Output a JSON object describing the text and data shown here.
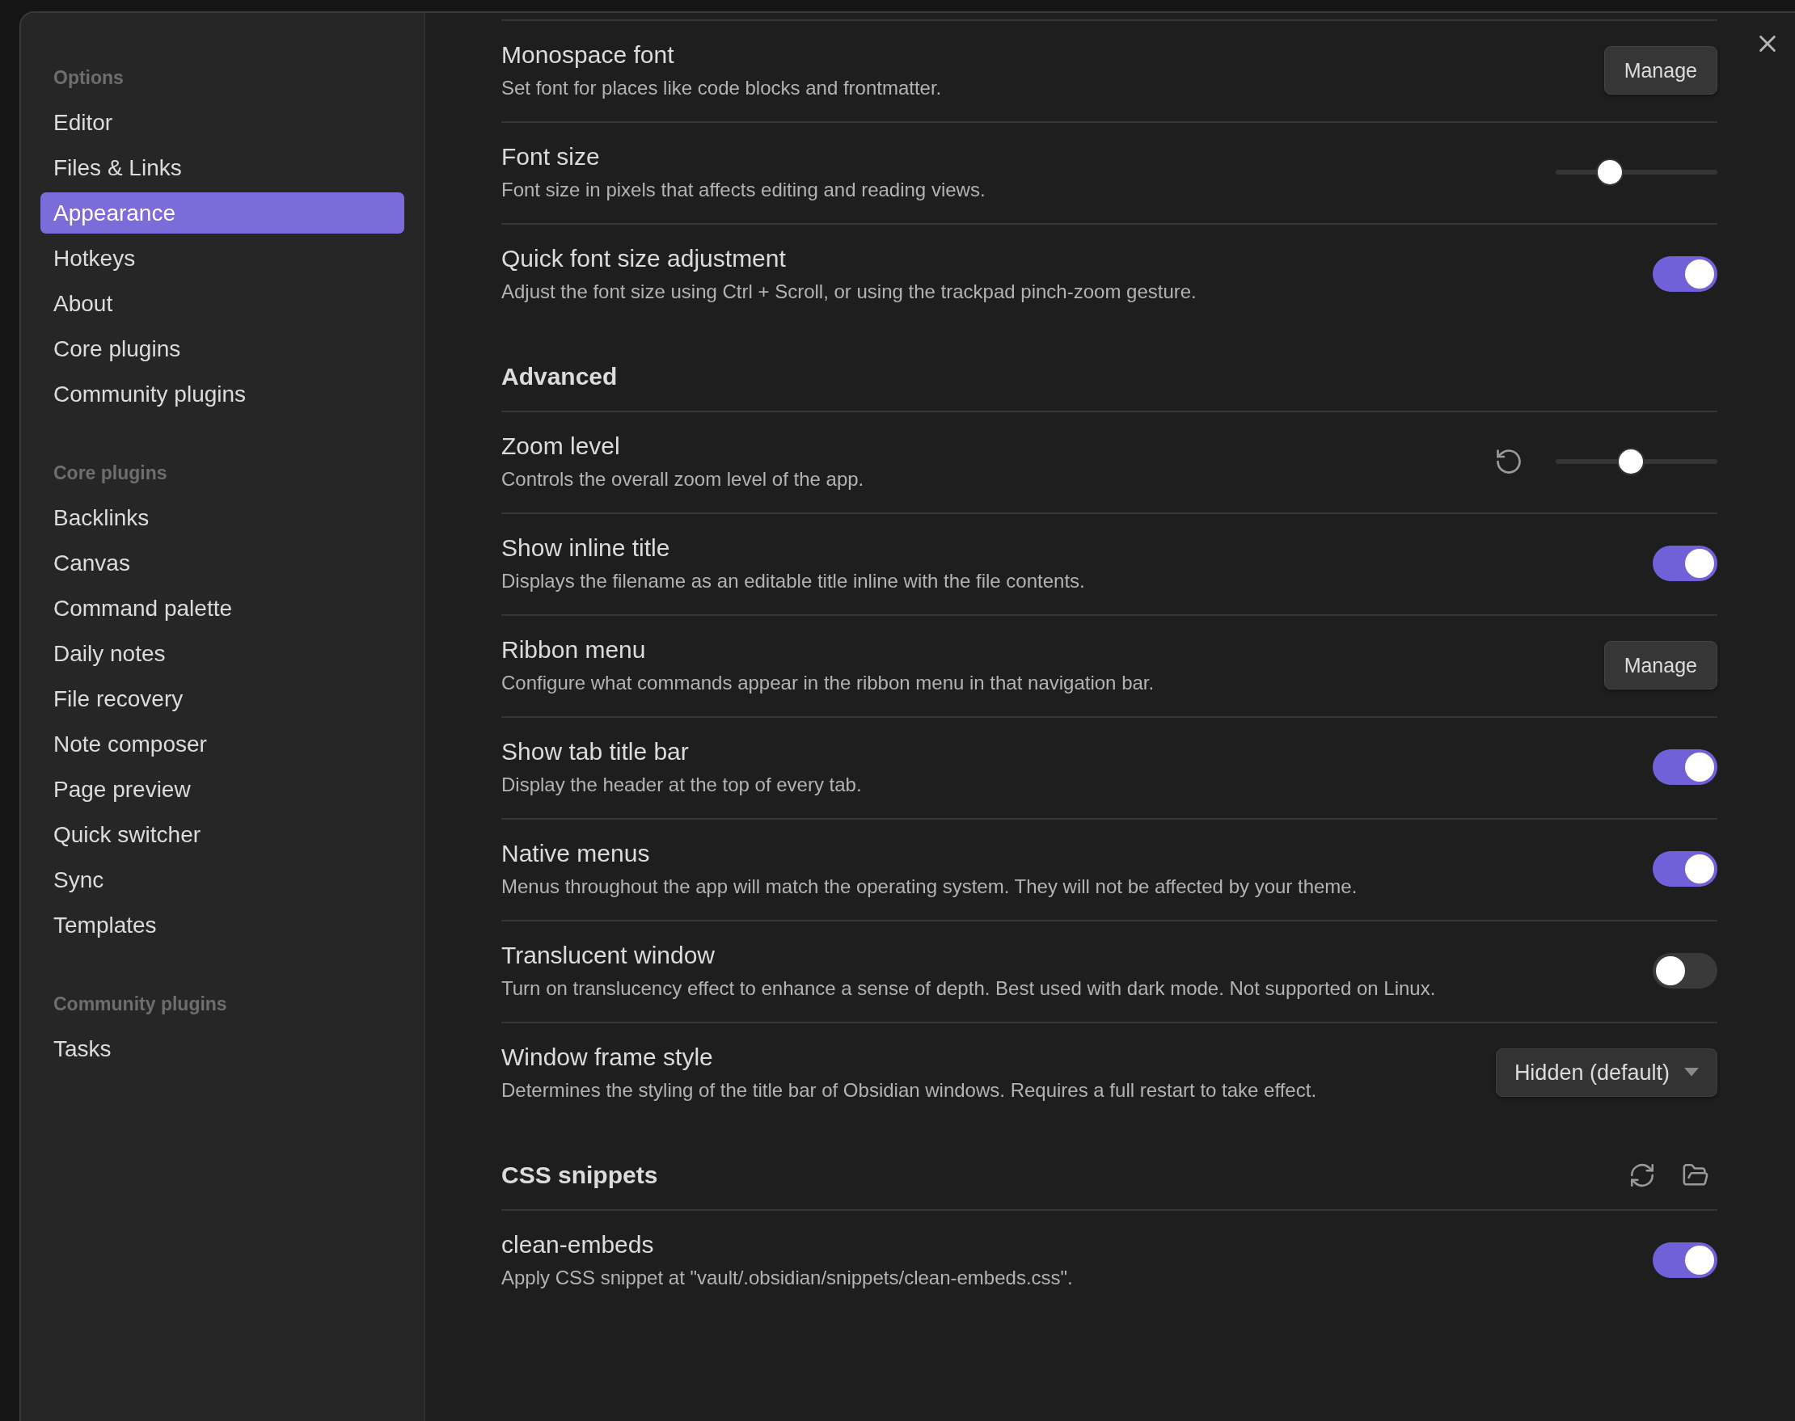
{
  "sidebar": [
    {
      "header": "Options",
      "items": [
        {
          "label": "Editor",
          "selected": false
        },
        {
          "label": "Files & Links",
          "selected": false
        },
        {
          "label": "Appearance",
          "selected": true
        },
        {
          "label": "Hotkeys",
          "selected": false
        },
        {
          "label": "About",
          "selected": false
        },
        {
          "label": "Core plugins",
          "selected": false
        },
        {
          "label": "Community plugins",
          "selected": false
        }
      ]
    },
    {
      "header": "Core plugins",
      "items": [
        {
          "label": "Backlinks",
          "selected": false
        },
        {
          "label": "Canvas",
          "selected": false
        },
        {
          "label": "Command palette",
          "selected": false
        },
        {
          "label": "Daily notes",
          "selected": false
        },
        {
          "label": "File recovery",
          "selected": false
        },
        {
          "label": "Note composer",
          "selected": false
        },
        {
          "label": "Page preview",
          "selected": false
        },
        {
          "label": "Quick switcher",
          "selected": false
        },
        {
          "label": "Sync",
          "selected": false
        },
        {
          "label": "Templates",
          "selected": false
        }
      ]
    },
    {
      "header": "Community plugins",
      "items": [
        {
          "label": "Tasks",
          "selected": false
        }
      ]
    }
  ],
  "settings": [
    {
      "kind": "setting",
      "name": "Monospace font",
      "description": "Set font for places like code blocks and frontmatter.",
      "control": {
        "kind": "button",
        "label": "Manage"
      }
    },
    {
      "kind": "setting",
      "name": "Font size",
      "description": "Font size in pixels that affects editing and reading views.",
      "control": {
        "kind": "slider",
        "level": 0.33,
        "reset_button": false
      }
    },
    {
      "kind": "setting",
      "name": "Quick font size adjustment",
      "description": "Adjust the font size using Ctrl + Scroll, or using the trackpad pinch-zoom gesture.",
      "control": {
        "kind": "toggle",
        "on": true
      }
    },
    {
      "kind": "heading",
      "name": "Advanced"
    },
    {
      "kind": "setting",
      "name": "Zoom level",
      "description": "Controls the overall zoom level of the app.",
      "control": {
        "kind": "slider",
        "level": 0.46,
        "reset_button": true
      }
    },
    {
      "kind": "setting",
      "name": "Show inline title",
      "description": "Displays the filename as an editable title inline with the file contents.",
      "control": {
        "kind": "toggle",
        "on": true
      }
    },
    {
      "kind": "setting",
      "name": "Ribbon menu",
      "description": "Configure what commands appear in the ribbon menu in that navigation bar.",
      "control": {
        "kind": "button",
        "label": "Manage"
      }
    },
    {
      "kind": "setting",
      "name": "Show tab title bar",
      "description": "Display the header at the top of every tab.",
      "control": {
        "kind": "toggle",
        "on": true
      }
    },
    {
      "kind": "setting",
      "name": "Native menus",
      "description": "Menus throughout the app will match the operating system. They will not be affected by your theme.",
      "control": {
        "kind": "toggle",
        "on": true
      }
    },
    {
      "kind": "setting",
      "name": "Translucent window",
      "description": "Turn on translucency effect to enhance a sense of depth. Best used with dark mode. Not supported on Linux.",
      "control": {
        "kind": "toggle",
        "on": false
      }
    },
    {
      "kind": "setting",
      "name": "Window frame style",
      "description": "Determines the styling of the title bar of Obsidian windows. Requires a full restart to take effect.",
      "control": {
        "kind": "dropdown",
        "value": "Hidden (default)"
      }
    },
    {
      "kind": "heading",
      "name": "CSS snippets",
      "actions": [
        {
          "kind": "reload"
        },
        {
          "kind": "folder"
        }
      ]
    },
    {
      "kind": "setting",
      "name": "clean-embeds",
      "description": "Apply CSS snippet at \"vault/.obsidian/snippets/clean-embeds.css\".",
      "control": {
        "kind": "toggle",
        "on": true
      }
    }
  ]
}
